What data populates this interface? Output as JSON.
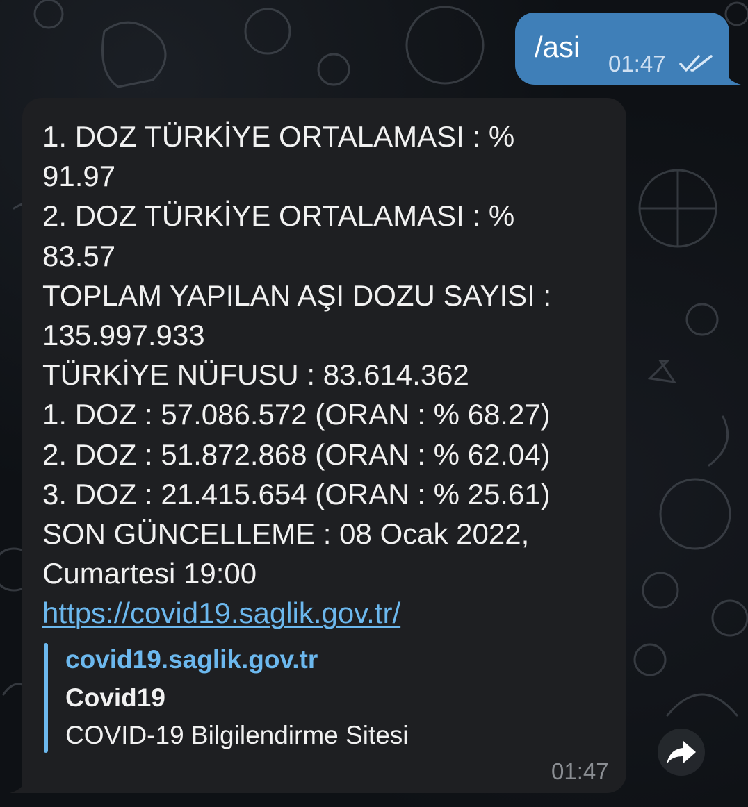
{
  "outgoing_message": {
    "text": "/asi",
    "time": "01:47",
    "status_icon": "double-check-icon"
  },
  "incoming_message": {
    "lines": [
      "1. DOZ TÜRKİYE ORTALAMASI : %",
      "91.97",
      "2. DOZ TÜRKİYE ORTALAMASI : %",
      "83.57",
      "TOPLAM YAPILAN AŞI DOZU SAYISI :",
      "135.997.933",
      "TÜRKİYE NÜFUSU : 83.614.362",
      "1. DOZ : 57.086.572 (ORAN : % 68.27)",
      "2. DOZ : 51.872.868 (ORAN : % 62.04)",
      "3. DOZ : 21.415.654 (ORAN : % 25.61)",
      "SON GÜNCELLEME : 08 Ocak 2022,",
      "Cumartesi 19:00"
    ],
    "link": "https://covid19.saglik.gov.tr/",
    "preview": {
      "site": "covid19.saglik.gov.tr",
      "title": "Covid19",
      "description": "COVID-19 Bilgilendirme Sitesi"
    },
    "time": "01:47"
  },
  "actions": {
    "share_icon": "share-arrow-icon"
  },
  "colors": {
    "background": "#0e1115",
    "outgoing_bubble": "#3f7fb8",
    "incoming_bubble": "#1e1f22",
    "link": "#6cb8ee",
    "message_text": "#f1f1f1",
    "incoming_time": "#8b8e93"
  }
}
